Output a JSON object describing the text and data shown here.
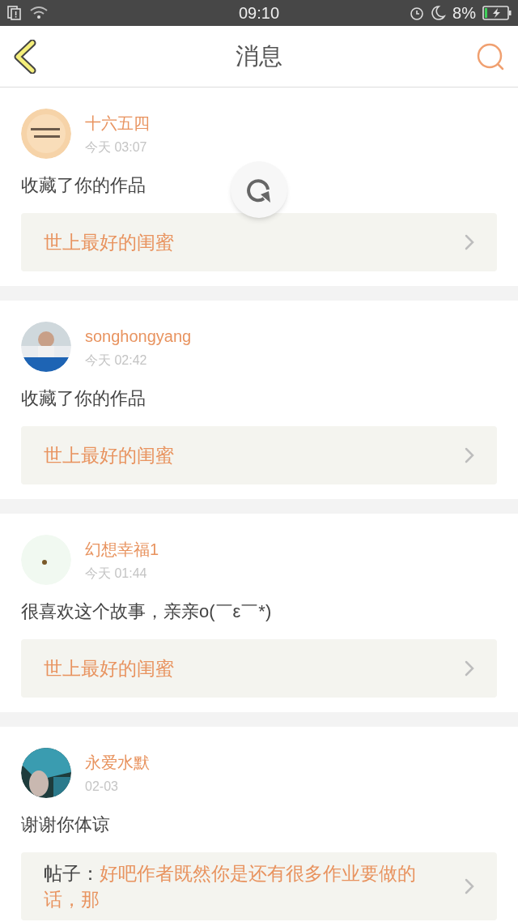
{
  "status_bar": {
    "time": "09:10",
    "battery": "8%"
  },
  "header": {
    "title": "消息"
  },
  "messages": [
    {
      "user": "十六五四",
      "time": "今天 03:07",
      "text": "收藏了你的作品",
      "link": {
        "kind": "work",
        "title": "世上最好的闺蜜"
      }
    },
    {
      "user": "songhongyang",
      "time": "今天 02:42",
      "text": "收藏了你的作品",
      "link": {
        "kind": "work",
        "title": "世上最好的闺蜜"
      }
    },
    {
      "user": "幻想幸福1",
      "time": "今天 01:44",
      "text": "很喜欢这个故事，亲亲o(￣ε￣*)",
      "link": {
        "kind": "work",
        "title": "世上最好的闺蜜"
      }
    },
    {
      "user": "永爱水默",
      "time": "02-03",
      "text": "谢谢你体谅",
      "link": {
        "kind": "post",
        "prefix": "帖子：",
        "title": "好吧作者既然你是还有很多作业要做的话，那"
      }
    }
  ]
}
